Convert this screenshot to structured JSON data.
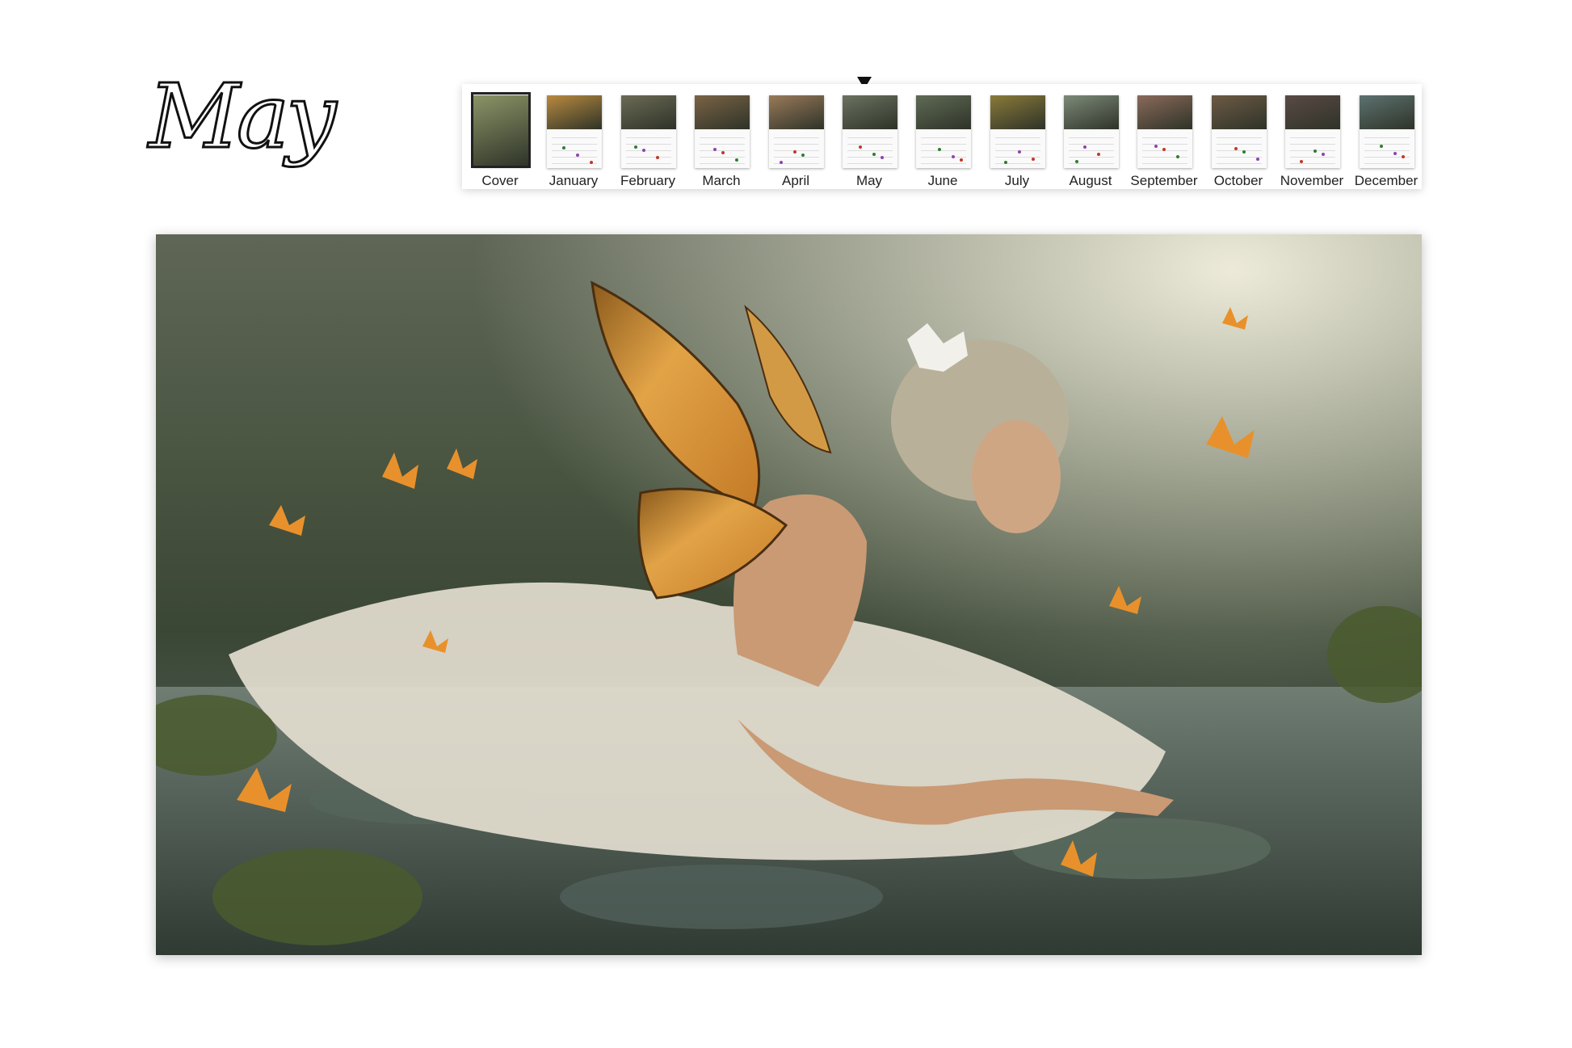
{
  "page": {
    "month_title": "May"
  },
  "month_nav": {
    "selected": "May",
    "items": [
      {
        "label": "Cover",
        "art": "#8a9466"
      },
      {
        "label": "January",
        "art": "#b98a3f"
      },
      {
        "label": "February",
        "art": "#6b6a55"
      },
      {
        "label": "March",
        "art": "#7a6345"
      },
      {
        "label": "April",
        "art": "#9a7a5a"
      },
      {
        "label": "May",
        "art": "#6b7260"
      },
      {
        "label": "June",
        "art": "#5f6a55"
      },
      {
        "label": "July",
        "art": "#8a7a3a"
      },
      {
        "label": "August",
        "art": "#7d8a7a"
      },
      {
        "label": "September",
        "art": "#8a6a5a"
      },
      {
        "label": "October",
        "art": "#6d5a45"
      },
      {
        "label": "November",
        "art": "#5a4a45"
      },
      {
        "label": "December",
        "art": "#5d7270"
      }
    ]
  },
  "hero_image": {
    "subject": "fairy-lying-on-lily-pond",
    "palette": {
      "wings": "#d9973a",
      "dress": "#e3ddcf",
      "water": "#5d6c64",
      "flowers": "#e8912c",
      "leaves": "#4a5a2e"
    }
  }
}
